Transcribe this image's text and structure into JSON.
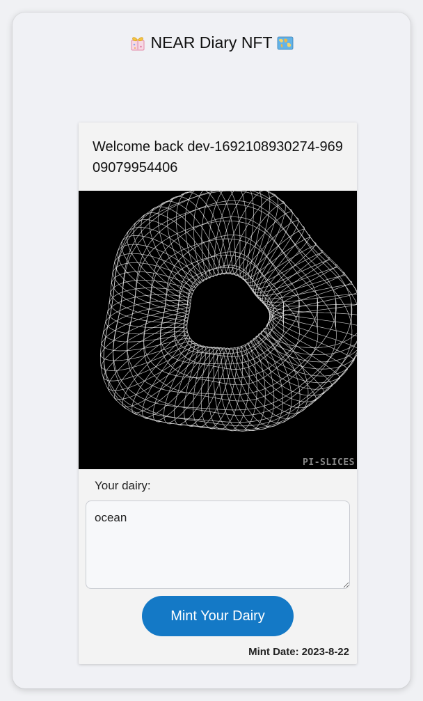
{
  "header": {
    "title": "NEAR Diary NFT",
    "left_icon": "ribbon-bow-icon",
    "right_icon": "world-map-icon"
  },
  "card": {
    "welcome_text": "Welcome back dev-1692108930274-96909079954406",
    "artwork_watermark": "PI-SLICES",
    "dairy_label": "Your dairy:",
    "dairy_value": "ocean",
    "mint_button_label": "Mint Your Dairy",
    "mint_date_label": "Mint Date:",
    "mint_date_value": "2023-8-22"
  },
  "colors": {
    "button": "#1479c6",
    "background": "#f0f1f4",
    "artwork_bg": "#000000"
  }
}
